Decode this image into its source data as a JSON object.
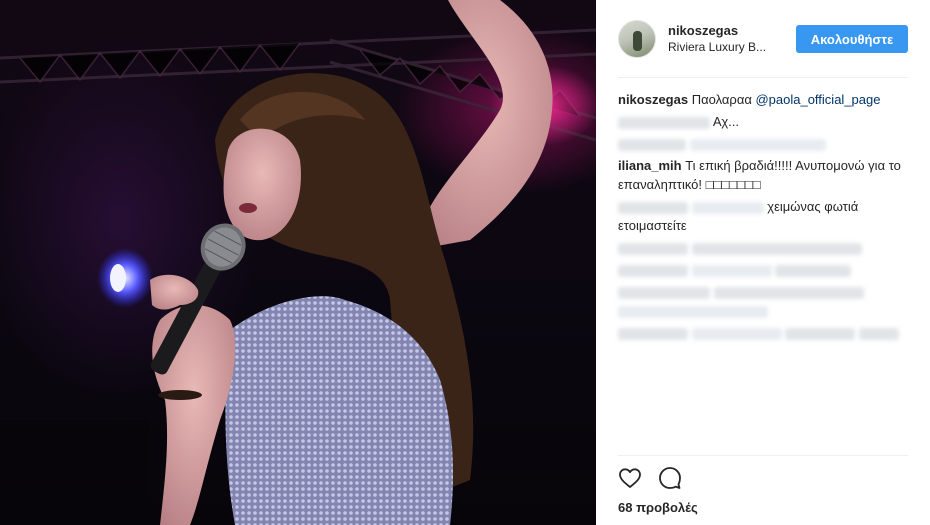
{
  "post": {
    "username": "nikoszegas",
    "location": "Riviera Luxury B...",
    "follow_label": "Ακολουθήστε",
    "views_count": "68",
    "views_label": "προβολές"
  },
  "comments": [
    {
      "user": "nikoszegas",
      "text": "Παολαραα ",
      "mention": "@paola_official_page"
    },
    {
      "user": "",
      "text": "Αχ...",
      "user_blurred": true
    },
    {
      "user": "",
      "text": "",
      "blurred": true
    },
    {
      "user": "iliana_mih",
      "text": "Τι επική βραδιά!!!!! Ανυπομονώ για το επαναληπτικό! □□□□□□□"
    },
    {
      "user": "",
      "text": "χειμώνας φωτιά ετοιμαστείτε",
      "user_blurred": true
    },
    {
      "user": "",
      "text": "",
      "blurred": true
    },
    {
      "user": "",
      "text": "",
      "blurred": true
    },
    {
      "user": "",
      "text": "",
      "blurred": true
    },
    {
      "user": "",
      "text": "",
      "blurred": true
    }
  ],
  "icons": {
    "like": "heart-icon",
    "comment": "comment-bubble-icon"
  },
  "colors": {
    "follow_button": "#3897f0",
    "mention": "#003569",
    "text": "#262626",
    "divider": "#efefef"
  }
}
